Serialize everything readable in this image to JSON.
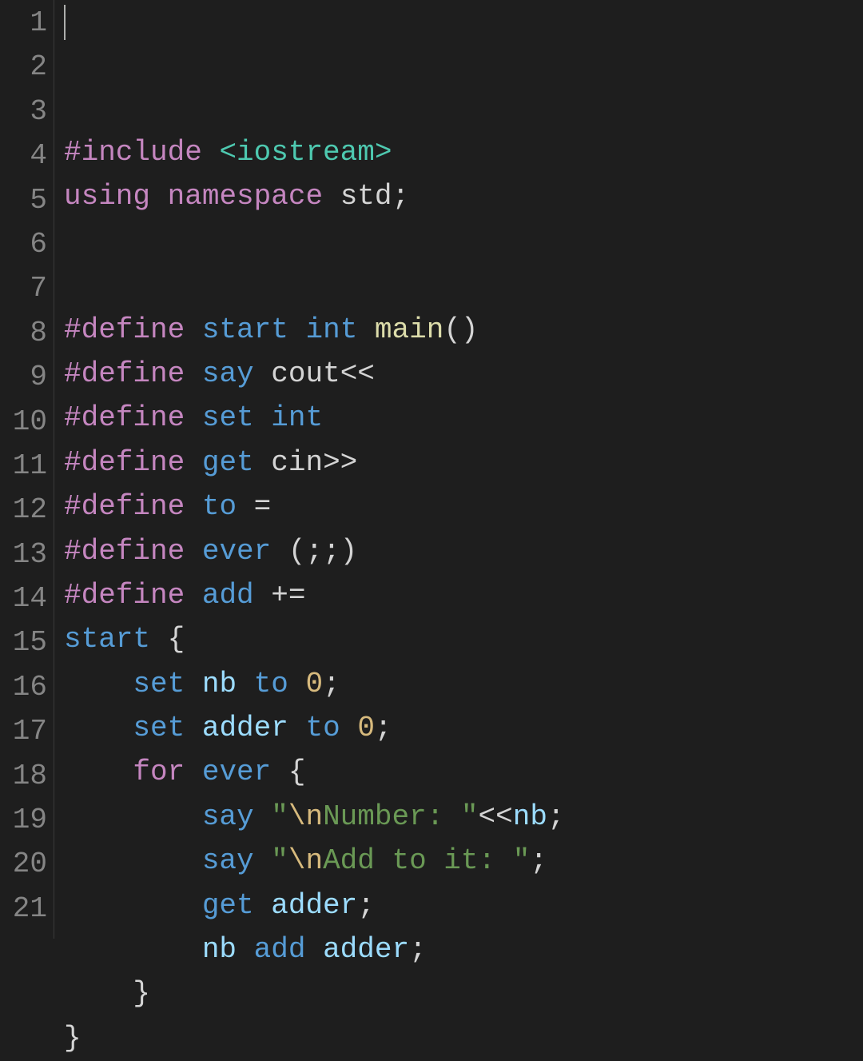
{
  "editor": {
    "language": "cpp",
    "cursor": {
      "line": 1,
      "col": 1
    },
    "lines": [
      {
        "num": 1,
        "tokens": [
          {
            "t": "#include",
            "cls": "tok-directive"
          },
          {
            "t": " ",
            "cls": "tok-default"
          },
          {
            "t": "<iostream>",
            "cls": "tok-include"
          }
        ]
      },
      {
        "num": 2,
        "tokens": [
          {
            "t": "using",
            "cls": "tok-keyword"
          },
          {
            "t": " ",
            "cls": "tok-default"
          },
          {
            "t": "namespace",
            "cls": "tok-keyword"
          },
          {
            "t": " ",
            "cls": "tok-default"
          },
          {
            "t": "std",
            "cls": "tok-ident"
          },
          {
            "t": ";",
            "cls": "tok-punc"
          }
        ]
      },
      {
        "num": 3,
        "tokens": []
      },
      {
        "num": 4,
        "tokens": []
      },
      {
        "num": 5,
        "tokens": [
          {
            "t": "#define",
            "cls": "tok-directive"
          },
          {
            "t": " ",
            "cls": "tok-default"
          },
          {
            "t": "start",
            "cls": "tok-macrodef"
          },
          {
            "t": " ",
            "cls": "tok-default"
          },
          {
            "t": "int",
            "cls": "tok-type"
          },
          {
            "t": " ",
            "cls": "tok-default"
          },
          {
            "t": "main",
            "cls": "tok-func"
          },
          {
            "t": "()",
            "cls": "tok-punc"
          }
        ]
      },
      {
        "num": 6,
        "tokens": [
          {
            "t": "#define",
            "cls": "tok-directive"
          },
          {
            "t": " ",
            "cls": "tok-default"
          },
          {
            "t": "say",
            "cls": "tok-macrodef"
          },
          {
            "t": " ",
            "cls": "tok-default"
          },
          {
            "t": "cout",
            "cls": "tok-ident"
          },
          {
            "t": "<<",
            "cls": "tok-punc"
          }
        ]
      },
      {
        "num": 7,
        "tokens": [
          {
            "t": "#define",
            "cls": "tok-directive"
          },
          {
            "t": " ",
            "cls": "tok-default"
          },
          {
            "t": "set",
            "cls": "tok-macrodef"
          },
          {
            "t": " ",
            "cls": "tok-default"
          },
          {
            "t": "int",
            "cls": "tok-type"
          }
        ]
      },
      {
        "num": 8,
        "tokens": [
          {
            "t": "#define",
            "cls": "tok-directive"
          },
          {
            "t": " ",
            "cls": "tok-default"
          },
          {
            "t": "get",
            "cls": "tok-macrodef"
          },
          {
            "t": " ",
            "cls": "tok-default"
          },
          {
            "t": "cin",
            "cls": "tok-ident"
          },
          {
            "t": ">>",
            "cls": "tok-punc"
          }
        ]
      },
      {
        "num": 9,
        "tokens": [
          {
            "t": "#define",
            "cls": "tok-directive"
          },
          {
            "t": " ",
            "cls": "tok-default"
          },
          {
            "t": "to",
            "cls": "tok-macrodef"
          },
          {
            "t": " ",
            "cls": "tok-default"
          },
          {
            "t": "=",
            "cls": "tok-punc"
          }
        ]
      },
      {
        "num": 10,
        "tokens": [
          {
            "t": "#define",
            "cls": "tok-directive"
          },
          {
            "t": " ",
            "cls": "tok-default"
          },
          {
            "t": "ever",
            "cls": "tok-macrodef"
          },
          {
            "t": " ",
            "cls": "tok-default"
          },
          {
            "t": "(;;)",
            "cls": "tok-punc"
          }
        ]
      },
      {
        "num": 11,
        "tokens": [
          {
            "t": "#define",
            "cls": "tok-directive"
          },
          {
            "t": " ",
            "cls": "tok-default"
          },
          {
            "t": "add",
            "cls": "tok-macrodef"
          },
          {
            "t": " ",
            "cls": "tok-default"
          },
          {
            "t": "+=",
            "cls": "tok-punc"
          }
        ]
      },
      {
        "num": 12,
        "tokens": [
          {
            "t": "start",
            "cls": "tok-macrodef"
          },
          {
            "t": " ",
            "cls": "tok-default"
          },
          {
            "t": "{",
            "cls": "tok-punc"
          }
        ]
      },
      {
        "num": 13,
        "tokens": [
          {
            "t": "    ",
            "cls": "tok-default"
          },
          {
            "t": "set",
            "cls": "tok-macrodef"
          },
          {
            "t": " ",
            "cls": "tok-default"
          },
          {
            "t": "nb",
            "cls": "tok-var"
          },
          {
            "t": " ",
            "cls": "tok-default"
          },
          {
            "t": "to",
            "cls": "tok-macrodef"
          },
          {
            "t": " ",
            "cls": "tok-default"
          },
          {
            "t": "0",
            "cls": "tok-num"
          },
          {
            "t": ";",
            "cls": "tok-punc"
          }
        ]
      },
      {
        "num": 14,
        "tokens": [
          {
            "t": "    ",
            "cls": "tok-default"
          },
          {
            "t": "set",
            "cls": "tok-macrodef"
          },
          {
            "t": " ",
            "cls": "tok-default"
          },
          {
            "t": "adder",
            "cls": "tok-var"
          },
          {
            "t": " ",
            "cls": "tok-default"
          },
          {
            "t": "to",
            "cls": "tok-macrodef"
          },
          {
            "t": " ",
            "cls": "tok-default"
          },
          {
            "t": "0",
            "cls": "tok-num"
          },
          {
            "t": ";",
            "cls": "tok-punc"
          }
        ]
      },
      {
        "num": 15,
        "tokens": [
          {
            "t": "    ",
            "cls": "tok-default"
          },
          {
            "t": "for",
            "cls": "tok-keyword"
          },
          {
            "t": " ",
            "cls": "tok-default"
          },
          {
            "t": "ever",
            "cls": "tok-macrodef"
          },
          {
            "t": " ",
            "cls": "tok-default"
          },
          {
            "t": "{",
            "cls": "tok-punc"
          }
        ]
      },
      {
        "num": 16,
        "tokens": [
          {
            "t": "        ",
            "cls": "tok-default"
          },
          {
            "t": "say",
            "cls": "tok-macrodef"
          },
          {
            "t": " ",
            "cls": "tok-default"
          },
          {
            "t": "\"",
            "cls": "tok-str"
          },
          {
            "t": "\\n",
            "cls": "tok-esc"
          },
          {
            "t": "Number: \"",
            "cls": "tok-str"
          },
          {
            "t": "<<",
            "cls": "tok-punc"
          },
          {
            "t": "nb",
            "cls": "tok-var"
          },
          {
            "t": ";",
            "cls": "tok-punc"
          }
        ]
      },
      {
        "num": 17,
        "tokens": [
          {
            "t": "        ",
            "cls": "tok-default"
          },
          {
            "t": "say",
            "cls": "tok-macrodef"
          },
          {
            "t": " ",
            "cls": "tok-default"
          },
          {
            "t": "\"",
            "cls": "tok-str"
          },
          {
            "t": "\\n",
            "cls": "tok-esc"
          },
          {
            "t": "Add to it: \"",
            "cls": "tok-str"
          },
          {
            "t": ";",
            "cls": "tok-punc"
          }
        ]
      },
      {
        "num": 18,
        "tokens": [
          {
            "t": "        ",
            "cls": "tok-default"
          },
          {
            "t": "get",
            "cls": "tok-macrodef"
          },
          {
            "t": " ",
            "cls": "tok-default"
          },
          {
            "t": "adder",
            "cls": "tok-var"
          },
          {
            "t": ";",
            "cls": "tok-punc"
          }
        ]
      },
      {
        "num": 19,
        "tokens": [
          {
            "t": "        ",
            "cls": "tok-default"
          },
          {
            "t": "nb",
            "cls": "tok-var"
          },
          {
            "t": " ",
            "cls": "tok-default"
          },
          {
            "t": "add",
            "cls": "tok-macrodef"
          },
          {
            "t": " ",
            "cls": "tok-default"
          },
          {
            "t": "adder",
            "cls": "tok-var"
          },
          {
            "t": ";",
            "cls": "tok-punc"
          }
        ]
      },
      {
        "num": 20,
        "tokens": [
          {
            "t": "    ",
            "cls": "tok-default"
          },
          {
            "t": "}",
            "cls": "tok-punc"
          }
        ]
      },
      {
        "num": 21,
        "tokens": [
          {
            "t": "}",
            "cls": "tok-punc"
          }
        ]
      }
    ]
  }
}
